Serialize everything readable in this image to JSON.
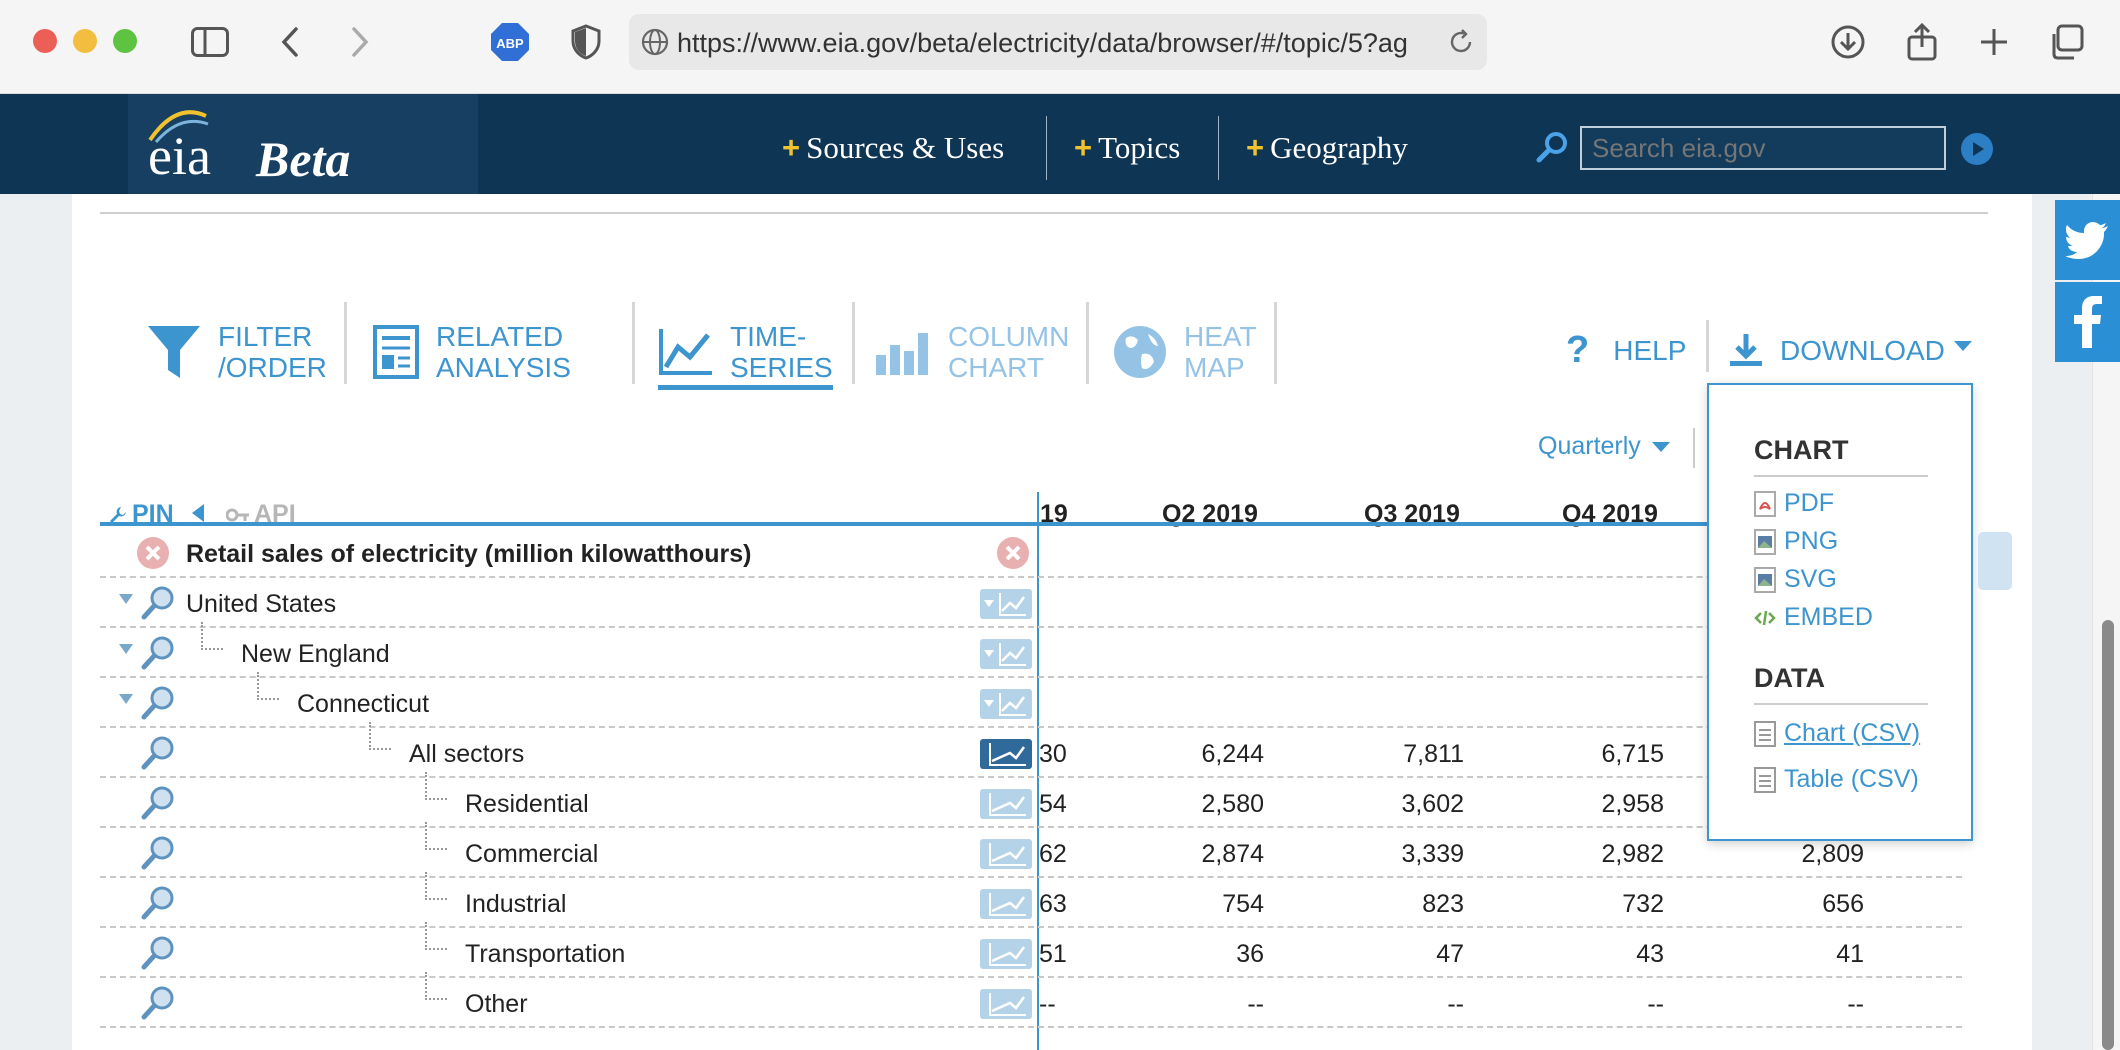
{
  "browser": {
    "url": "https://www.eia.gov/beta/electricity/data/browser/#/topic/5?ag",
    "abp_label": "ABP"
  },
  "header": {
    "logo_text": "eia",
    "beta_text": "Beta",
    "nav": [
      {
        "label": "Sources & Uses"
      },
      {
        "label": "Topics"
      },
      {
        "label": "Geography"
      }
    ],
    "nav_plus": "+",
    "search_placeholder": "Search eia.gov"
  },
  "toolbar": {
    "filter": "FILTER\n/ORDER",
    "related": "RELATED\nANALYSIS",
    "timeseries": "TIME-\nSERIES",
    "column": "COLUMN\nCHART",
    "heatmap": "HEAT\nMAP",
    "help": "HELP",
    "download": "DOWNLOAD"
  },
  "frequency": "Quarterly",
  "table_controls": {
    "pin": "PIN",
    "api": "API"
  },
  "columns": [
    "19",
    "Q2 2019",
    "Q3 2019",
    "Q4 2019"
  ],
  "series_title": "Retail sales of electricity (million kilowatthours)",
  "rows": [
    {
      "label": "United States",
      "values": [
        "",
        "",
        "",
        "",
        ""
      ]
    },
    {
      "label": "New England",
      "values": [
        "",
        "",
        "",
        "",
        ""
      ]
    },
    {
      "label": "Connecticut",
      "values": [
        "",
        "",
        "",
        "",
        ""
      ]
    },
    {
      "label": "All sectors",
      "values": [
        "30",
        "6,244",
        "7,811",
        "6,715",
        ""
      ]
    },
    {
      "label": "Residential",
      "values": [
        "54",
        "2,580",
        "3,602",
        "2,958",
        ""
      ]
    },
    {
      "label": "Commercial",
      "values": [
        "62",
        "2,874",
        "3,339",
        "2,982",
        "2,809"
      ]
    },
    {
      "label": "Industrial",
      "values": [
        "63",
        "754",
        "823",
        "732",
        "656"
      ]
    },
    {
      "label": "Transportation",
      "values": [
        "51",
        "36",
        "47",
        "43",
        "41"
      ]
    },
    {
      "label": "Other",
      "values": [
        "--",
        "--",
        "--",
        "--",
        "--"
      ]
    }
  ],
  "download_menu": {
    "chart_header": "CHART",
    "chart_items": [
      "PDF",
      "PNG",
      "SVG",
      "EMBED"
    ],
    "data_header": "DATA",
    "data_items": [
      "Chart (CSV)",
      "Table (CSV)"
    ]
  },
  "colors": {
    "accent": "#3d95cf",
    "header_bg": "#0f3554",
    "twitter": "#2b8fd6"
  }
}
